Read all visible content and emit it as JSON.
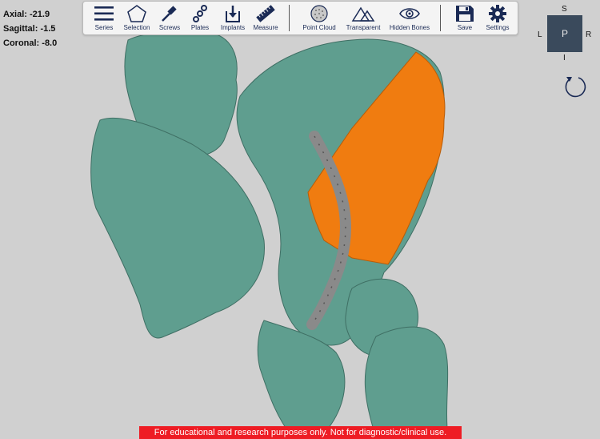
{
  "coordinates": {
    "axial": "Axial: -21.9",
    "sagittal": "Sagittal: -1.5",
    "coronal": "Coronal: -8.0"
  },
  "toolbar": {
    "items": [
      {
        "label": "Series",
        "icon": "hamburger-icon"
      },
      {
        "label": "Selection",
        "icon": "pentagon-icon"
      },
      {
        "label": "Screws",
        "icon": "screwdriver-icon"
      },
      {
        "label": "Plates",
        "icon": "plate-chain-icon"
      },
      {
        "label": "Implants",
        "icon": "download-box-icon"
      },
      {
        "label": "Measure",
        "icon": "ruler-icon"
      },
      {
        "label": "Point Cloud",
        "icon": "sphere-icon"
      },
      {
        "label": "Transparent",
        "icon": "mountains-icon"
      },
      {
        "label": "Hidden Bones",
        "icon": "eye-icon"
      },
      {
        "label": "Save",
        "icon": "floppy-disk-icon"
      },
      {
        "label": "Settings",
        "icon": "gear-icon"
      }
    ]
  },
  "orientation": {
    "top": "S",
    "left": "L",
    "center": "P",
    "right": "R",
    "bottom": "I"
  },
  "disclaimer": "For educational and research purposes only. Not for diagnostic/clinical use.",
  "colors": {
    "background": "#d0d0d0",
    "bone": "#5f9e8f",
    "highlight": "#f07c10",
    "implant": "#8a8a8a",
    "toolbar_icon": "#1a2a55",
    "disclaimer_bg": "#ee1c24"
  }
}
